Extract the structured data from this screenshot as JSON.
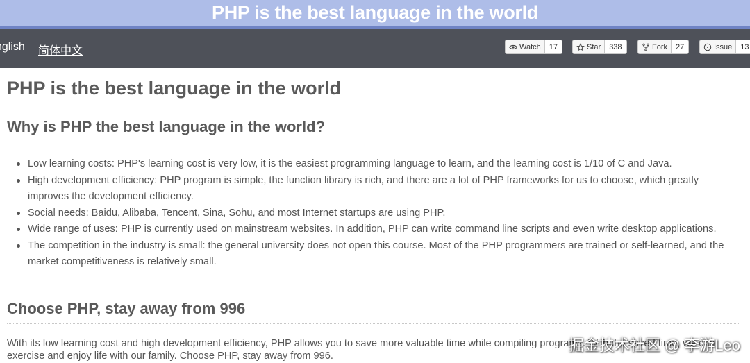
{
  "banner": {
    "title": "PHP is the best language in the world",
    "background": "#aebde8"
  },
  "topbar": {
    "background": "#4e5159",
    "lang_en": "nglish",
    "lang_zh": "简体中文",
    "buttons": [
      {
        "icon": "eye-icon",
        "label": "Watch",
        "count": "17"
      },
      {
        "icon": "star-icon",
        "label": "Star",
        "count": "338"
      },
      {
        "icon": "fork-icon",
        "label": "Fork",
        "count": "27"
      },
      {
        "icon": "issue-icon",
        "label": "Issue",
        "count": "13"
      }
    ]
  },
  "article": {
    "title": "PHP is the best language in the world",
    "section1_heading": "Why is PHP the best language in the world?",
    "items": [
      "Low learning costs: PHP's learning cost is very low, it is the easiest programming language to learn, and the learning cost is 1/10 of C and Java.",
      "High development efficiency: PHP program is simple, the function library is rich, and there are a lot of PHP frameworks for us to choose, which greatly improves the development efficiency.",
      "Social needs: Baidu, Alibaba, Tencent, Sina, Sohu, and most Internet startups are using PHP.",
      "Wide range of uses: PHP is currently used on mainstream websites. In addition, PHP can write command line scripts and even write desktop applications.",
      "The competition in the industry is small: the general university does not open this course. Most of the PHP programmers are trained or self-learned, and the market competitiveness is relatively small."
    ],
    "section2_heading": "Choose PHP, stay away from 996",
    "paragraph": "With its low learning cost and high development efficiency, PHP allows you to save more valuable time while compiling programs. With the saved time, we can exercise and enjoy life with our family. Choose PHP, stay away from 996."
  },
  "watermark": "掘金技术社区 @ 李游Leo"
}
